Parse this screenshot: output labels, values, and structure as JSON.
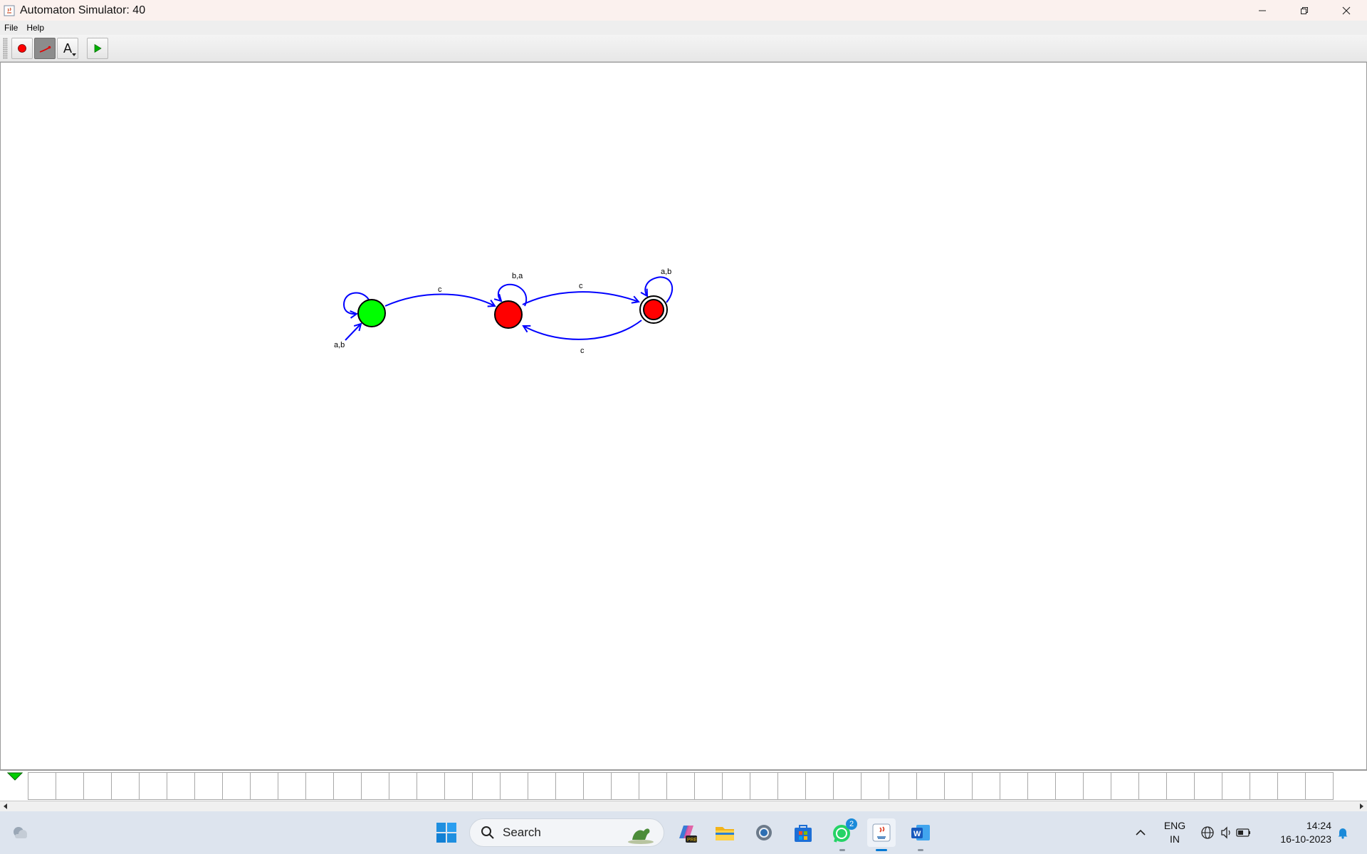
{
  "window": {
    "title": "Automaton Simulator: 40"
  },
  "menu": [
    {
      "label": "File"
    },
    {
      "label": "Help"
    }
  ],
  "toolbar": {
    "tools": [
      {
        "name": "state-tool",
        "icon": "red-dot-icon",
        "selected": false
      },
      {
        "name": "transition-tool",
        "icon": "transition-arrow-icon",
        "selected": true
      },
      {
        "name": "text-tool",
        "icon": "text-a-icon",
        "selected": false
      },
      {
        "name": "run-tool",
        "icon": "play-icon",
        "selected": false
      }
    ],
    "text_tool_glyph": "A"
  },
  "automaton": {
    "states": [
      {
        "id": "q0",
        "fill": "#00ff00",
        "initial": true,
        "accepting": false
      },
      {
        "id": "q1",
        "fill": "#ff0000",
        "initial": false,
        "accepting": false
      },
      {
        "id": "q2",
        "fill": "#ff0000",
        "initial": false,
        "accepting": true
      }
    ],
    "transitions": [
      {
        "from": "q0",
        "to": "q0",
        "label": "a,b"
      },
      {
        "from": "q0",
        "to": "q1",
        "label": "c"
      },
      {
        "from": "q1",
        "to": "q1",
        "label": "b,a"
      },
      {
        "from": "q1",
        "to": "q2",
        "label": "c"
      },
      {
        "from": "q2",
        "to": "q2",
        "label": "a,b"
      },
      {
        "from": "q2",
        "to": "q1",
        "label": "c"
      }
    ],
    "edge_color": "#0000ff"
  },
  "tape": {
    "cell_count": 47
  },
  "taskbar": {
    "search_label": "Search",
    "whatsapp_badge": "2",
    "language_line1": "ENG",
    "language_line2": "IN",
    "time": "14:24",
    "date": "16-10-2023",
    "pinned": [
      "copilot-icon",
      "file-explorer-icon",
      "settings-icon",
      "microsoft-store-icon",
      "whatsapp-icon",
      "java-icon",
      "word-icon"
    ]
  },
  "colors": {
    "accent": "#0078d4",
    "taskbar": "#dde4ee"
  }
}
